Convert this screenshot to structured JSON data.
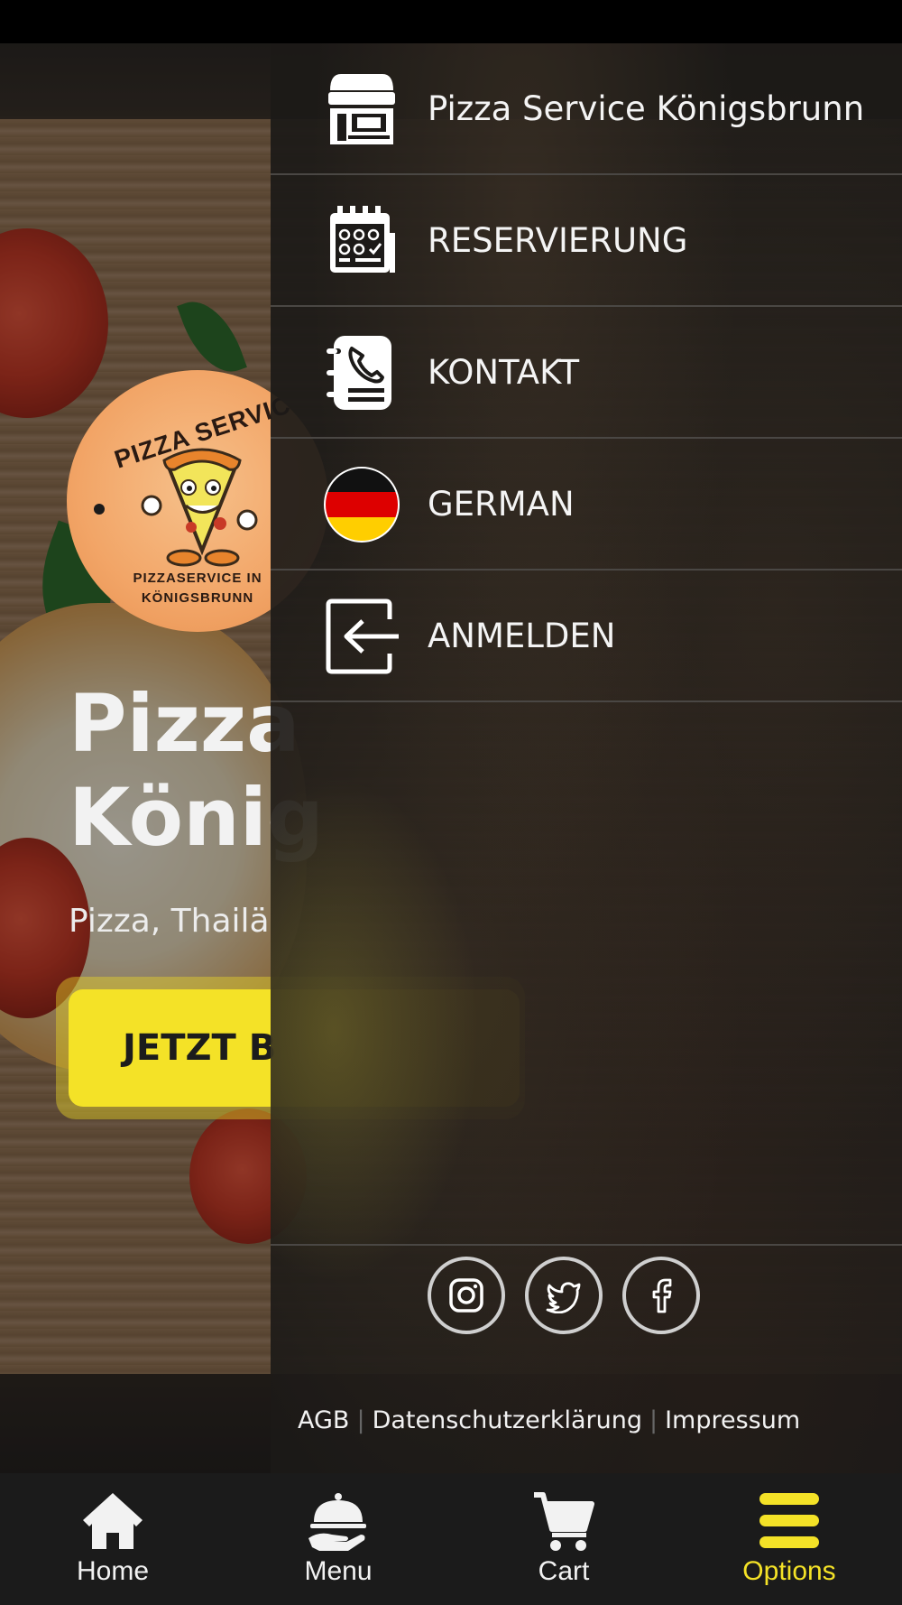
{
  "background": {
    "logo": {
      "top_text": "PIZZA SERVICE",
      "bottom_line1": "PIZZASERVICE IN",
      "bottom_line2": "KÖNIGSBRUNN"
    },
    "hero_title": "Pizza\nKönig",
    "hero_subtitle": "Pizza, Thailä",
    "order_button_label": "JETZT B"
  },
  "drawer": {
    "items": [
      {
        "label": "Pizza Service Königsbrunn",
        "icon": "storefront-icon"
      },
      {
        "label": "RESERVIERUNG",
        "icon": "calendar-icon"
      },
      {
        "label": "KONTAKT",
        "icon": "contact-book-icon"
      },
      {
        "label": "GERMAN",
        "icon": "german-flag-icon"
      },
      {
        "label": "ANMELDEN",
        "icon": "login-icon"
      }
    ],
    "social": [
      "instagram-icon",
      "twitter-icon",
      "facebook-icon"
    ],
    "footer": {
      "agb": "AGB",
      "privacy": "Datenschutzerklärung",
      "imprint": "Impressum",
      "separator": "|"
    }
  },
  "bottom_nav": {
    "items": [
      {
        "label": "Home",
        "icon": "home-icon"
      },
      {
        "label": "Menu",
        "icon": "cloche-icon"
      },
      {
        "label": "Cart",
        "icon": "cart-icon"
      },
      {
        "label": "Options",
        "icon": "hamburger-icon",
        "active": true
      }
    ]
  },
  "colors": {
    "accent": "#f4e227",
    "nav_background": "#1b1b1b",
    "drawer_background": "#1c1a18",
    "text": "#f4f4f4"
  }
}
